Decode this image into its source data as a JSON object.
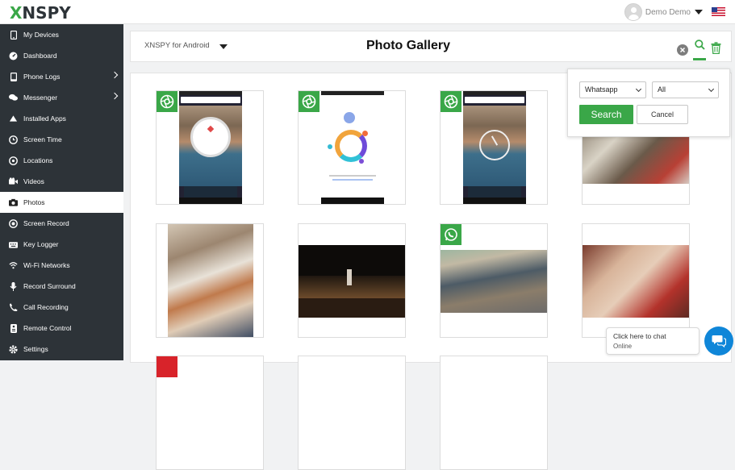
{
  "app": {
    "logo_text": "XNSPY",
    "brand_color": "#3aa748",
    "user_name": "Demo Demo",
    "locale_icon": "us-flag-icon"
  },
  "sidebar": {
    "items": [
      {
        "label": "My Devices",
        "icon": "phone-icon",
        "active": false,
        "submenu": false
      },
      {
        "label": "Dashboard",
        "icon": "dashboard-icon",
        "active": false,
        "submenu": false
      },
      {
        "label": "Phone Logs",
        "icon": "phone-icon",
        "active": false,
        "submenu": true
      },
      {
        "label": "Messenger",
        "icon": "messenger-icon",
        "active": false,
        "submenu": true
      },
      {
        "label": "Installed Apps",
        "icon": "apps-icon",
        "active": false,
        "submenu": false
      },
      {
        "label": "Screen Time",
        "icon": "clock-icon",
        "active": false,
        "submenu": false
      },
      {
        "label": "Locations",
        "icon": "location-icon",
        "active": false,
        "submenu": false
      },
      {
        "label": "Videos",
        "icon": "video-icon",
        "active": false,
        "submenu": false
      },
      {
        "label": "Photos",
        "icon": "camera-icon",
        "active": true,
        "submenu": false
      },
      {
        "label": "Screen Record",
        "icon": "record-icon",
        "active": false,
        "submenu": false
      },
      {
        "label": "Key Logger",
        "icon": "keyboard-icon",
        "active": false,
        "submenu": false
      },
      {
        "label": "Wi-Fi Networks",
        "icon": "wifi-icon",
        "active": false,
        "submenu": false
      },
      {
        "label": "Record Surround",
        "icon": "microphone-icon",
        "active": false,
        "submenu": false
      },
      {
        "label": "Call Recording",
        "icon": "call-icon",
        "active": false,
        "submenu": false
      },
      {
        "label": "Remote Control",
        "icon": "remote-icon",
        "active": false,
        "submenu": false
      },
      {
        "label": "Settings",
        "icon": "gear-icon",
        "active": false,
        "submenu": false
      }
    ]
  },
  "header": {
    "device_label": "XNSPY for Android",
    "title": "Photo Gallery"
  },
  "filter": {
    "app_selected": "Whatsapp",
    "type_selected": "All",
    "search_label": "Search",
    "cancel_label": "Cancel"
  },
  "chat": {
    "prompt": "Click here to chat",
    "status": "Online"
  },
  "gallery": {
    "tiles": [
      {
        "source": "camera-icon",
        "content": "phone-screenshot-google-heart"
      },
      {
        "source": "camera-icon",
        "content": "phone-screenshot-google-fit"
      },
      {
        "source": "camera-icon",
        "content": "phone-screenshot-clock"
      },
      {
        "source": "none",
        "content": "office-desk-photo"
      },
      {
        "source": "none",
        "content": "office-cubicle-photo"
      },
      {
        "source": "none",
        "content": "stage-performance-photo"
      },
      {
        "source": "whatsapp-icon",
        "content": "classroom-photo"
      },
      {
        "source": "none",
        "content": "group-selfie-photo"
      }
    ]
  }
}
